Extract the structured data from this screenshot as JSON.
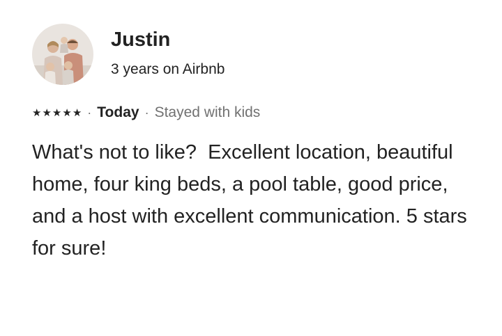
{
  "reviewer": {
    "name": "Justin",
    "tenure": "3 years on Airbnb",
    "avatar_icon": "family-photo-avatar"
  },
  "review": {
    "rating": 5,
    "stars": [
      "★",
      "★",
      "★",
      "★",
      "★"
    ],
    "separator": "·",
    "date": "Today",
    "trip_type": "Stayed with kids",
    "text": "What's not to like?  Excellent location, beautiful home, four king beds, a pool table, good price, and a host with excellent communication. 5 stars for sure!"
  },
  "colors": {
    "primary_text": "#222222",
    "secondary_text": "#717171",
    "background": "#ffffff"
  }
}
